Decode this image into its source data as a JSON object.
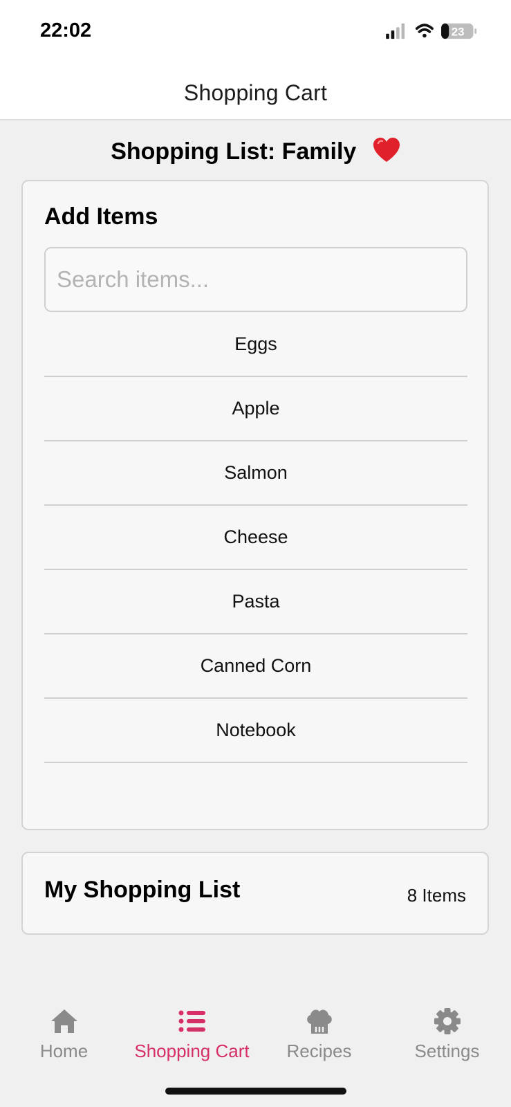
{
  "status_bar": {
    "time": "22:02",
    "battery": "23"
  },
  "header": {
    "title": "Shopping Cart"
  },
  "list_title": "Shopping List: Family",
  "add_items": {
    "title": "Add Items",
    "search_placeholder": "Search items...",
    "items": [
      "Eggs",
      "Apple",
      "Salmon",
      "Cheese",
      "Pasta",
      "Canned Corn",
      "Notebook"
    ]
  },
  "my_list": {
    "title": "My Shopping List",
    "count": "8 Items"
  },
  "tabs": [
    {
      "label": "Home",
      "icon": "home-icon"
    },
    {
      "label": "Shopping Cart",
      "icon": "list-icon",
      "active": true
    },
    {
      "label": "Recipes",
      "icon": "chef-hat-icon"
    },
    {
      "label": "Settings",
      "icon": "gear-icon"
    }
  ],
  "colors": {
    "accent": "#d62e66",
    "inactive": "#8a8a8a",
    "heart": "#e0202a"
  }
}
